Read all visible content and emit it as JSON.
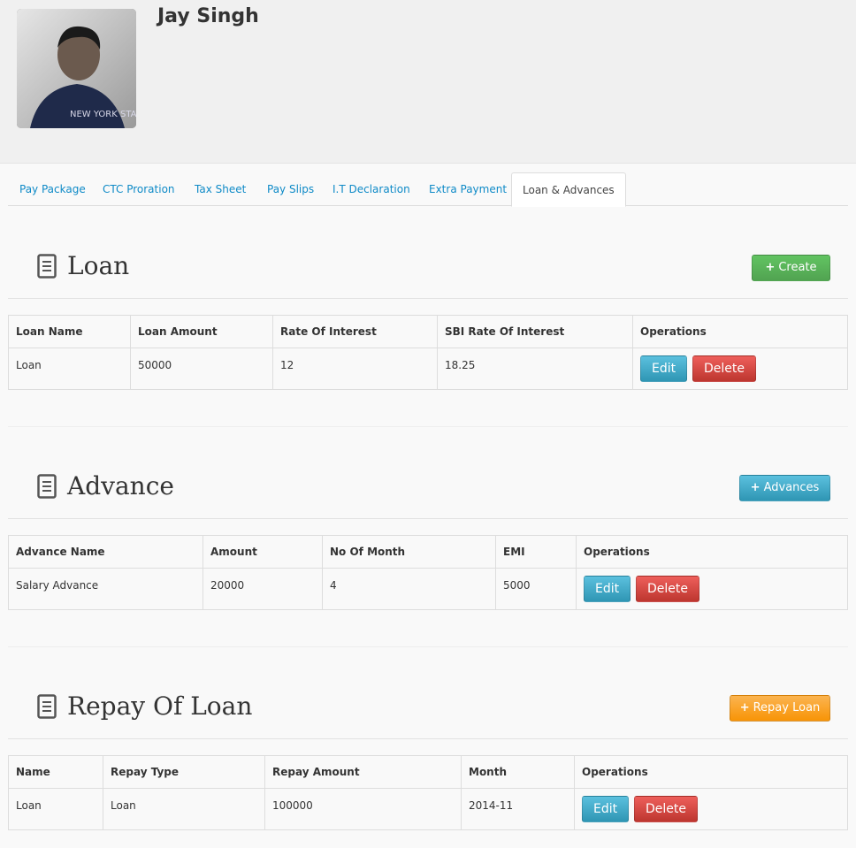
{
  "profile": {
    "name": "Jay Singh"
  },
  "tabs": [
    {
      "label": "Pay Package"
    },
    {
      "label": "CTC Proration"
    },
    {
      "label": "Tax Sheet"
    },
    {
      "label": "Pay Slips"
    },
    {
      "label": "I.T Declaration"
    },
    {
      "label": "Extra Payment"
    },
    {
      "label": "Loan & Advances",
      "active": true
    }
  ],
  "loan": {
    "title": "Loan",
    "action_label": "Create",
    "columns": [
      "Loan Name",
      "Loan Amount",
      "Rate Of Interest",
      "SBI Rate Of Interest",
      "Operations"
    ],
    "rows": [
      {
        "cells": [
          "Loan",
          "50000",
          "12",
          "18.25"
        ],
        "edit": "Edit",
        "delete": "Delete"
      }
    ]
  },
  "advance": {
    "title": "Advance",
    "action_label": "Advances",
    "columns": [
      "Advance Name",
      "Amount",
      "No Of Month",
      "EMI",
      "Operations"
    ],
    "rows": [
      {
        "cells": [
          "Salary Advance",
          "20000",
          "4",
          "5000"
        ],
        "edit": "Edit",
        "delete": "Delete"
      }
    ]
  },
  "repay": {
    "title": "Repay Of Loan",
    "action_label": "Repay Loan",
    "columns": [
      "Name",
      "Repay Type",
      "Repay Amount",
      "Month",
      "Operations"
    ],
    "rows": [
      {
        "cells": [
          "Loan",
          "Loan",
          "100000",
          "2014-11"
        ],
        "edit": "Edit",
        "delete": "Delete"
      }
    ]
  },
  "colors": {
    "tab_link": "#0e8ac7",
    "create_green": "#5bb75b",
    "advances_blue": "#49afcd",
    "repay_orange": "#faa732",
    "delete_red": "#da4f49"
  }
}
